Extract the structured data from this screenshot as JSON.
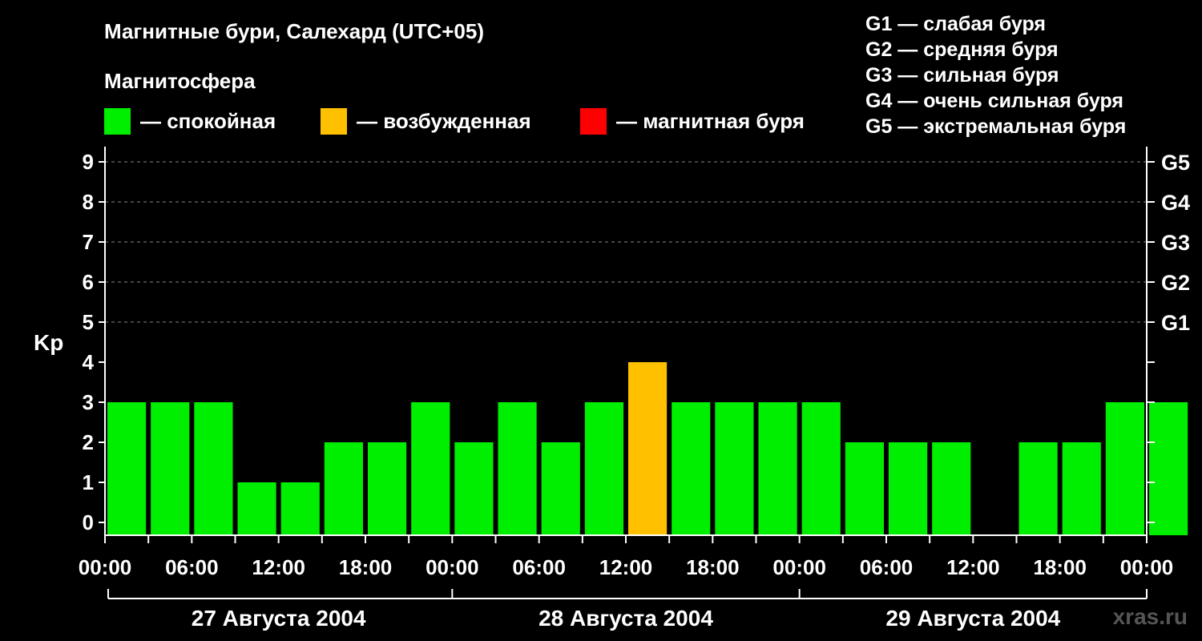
{
  "title": "Магнитные бури, Салехард (UTC+05)",
  "subtitle": "Магнитосфера",
  "legend": [
    {
      "label": "— спокойная",
      "color": "#00ee00"
    },
    {
      "label": "— возбужденная",
      "color": "#ffc000"
    },
    {
      "label": "— магнитная буря",
      "color": "#ff0000"
    }
  ],
  "g_levels": [
    "G1 — слабая буря",
    "G2 — средняя буря",
    "G3 — сильная буря",
    "G4 — очень сильная буря",
    "G5 — экстремальная буря"
  ],
  "watermark": "xras.ru",
  "chart_data": {
    "type": "bar",
    "ylabel": "Kp",
    "ylim": [
      0,
      9
    ],
    "yticks": [
      0,
      1,
      2,
      3,
      4,
      5,
      6,
      7,
      8,
      9
    ],
    "g_ticks": [
      {
        "kp": 5,
        "label": "G1"
      },
      {
        "kp": 6,
        "label": "G2"
      },
      {
        "kp": 7,
        "label": "G3"
      },
      {
        "kp": 8,
        "label": "G4"
      },
      {
        "kp": 9,
        "label": "G5"
      }
    ],
    "xtick_labels": [
      "00:00",
      "06:00",
      "12:00",
      "18:00",
      "00:00",
      "06:00",
      "12:00",
      "18:00",
      "00:00",
      "06:00",
      "12:00",
      "18:00",
      "00:00"
    ],
    "days": [
      "27 Августа 2004",
      "28 Августа 2004",
      "29 Августа 2004"
    ],
    "grid": "horizontal dashed at Kp 5-9",
    "values": [
      3,
      3,
      3,
      1,
      1,
      2,
      2,
      3,
      2,
      3,
      2,
      3,
      4,
      3,
      3,
      3,
      3,
      2,
      2,
      2,
      0,
      2,
      2,
      3,
      3
    ],
    "colors": {
      "quiet": "#00ee00",
      "active": "#ffc000",
      "storm": "#ff0000"
    }
  }
}
